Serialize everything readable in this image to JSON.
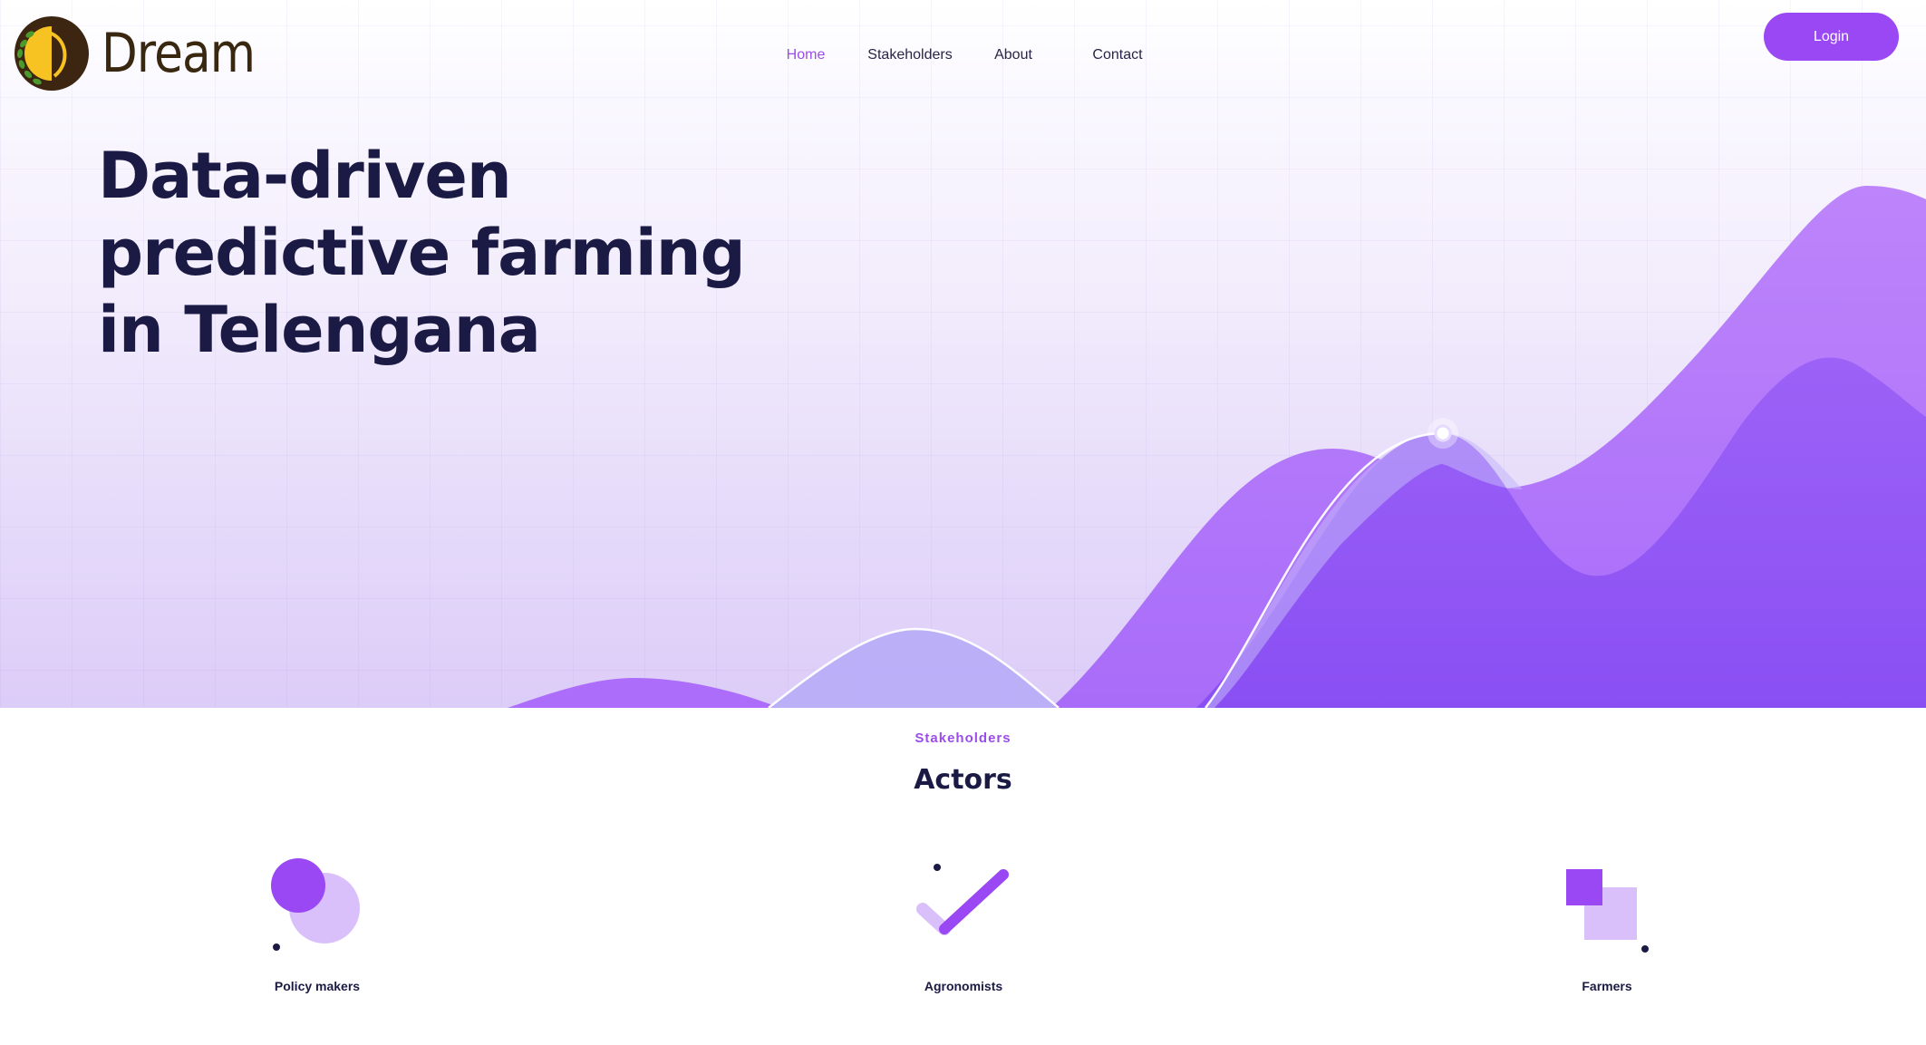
{
  "brand": {
    "name": "Dream"
  },
  "nav": {
    "items": [
      {
        "label": "Home",
        "active": true
      },
      {
        "label": "Stakeholders",
        "active": false
      },
      {
        "label": "About",
        "active": false
      },
      {
        "label": "Contact",
        "active": false
      }
    ],
    "login_label": "Login"
  },
  "hero": {
    "lines": [
      "Data-driven",
      "predictive farming",
      "in Telengana"
    ]
  },
  "stakeholders": {
    "label": "Stakeholders",
    "title": "Actors",
    "actors": [
      {
        "label": "Policy makers",
        "icon": "circles-icon"
      },
      {
        "label": "Agronomists",
        "icon": "checkmark-icon"
      },
      {
        "label": "Farmers",
        "icon": "squares-icon"
      }
    ]
  },
  "colors": {
    "accent": "#9a48f3",
    "heading": "#1b1a44",
    "light_purple": "#d9c0fb"
  }
}
